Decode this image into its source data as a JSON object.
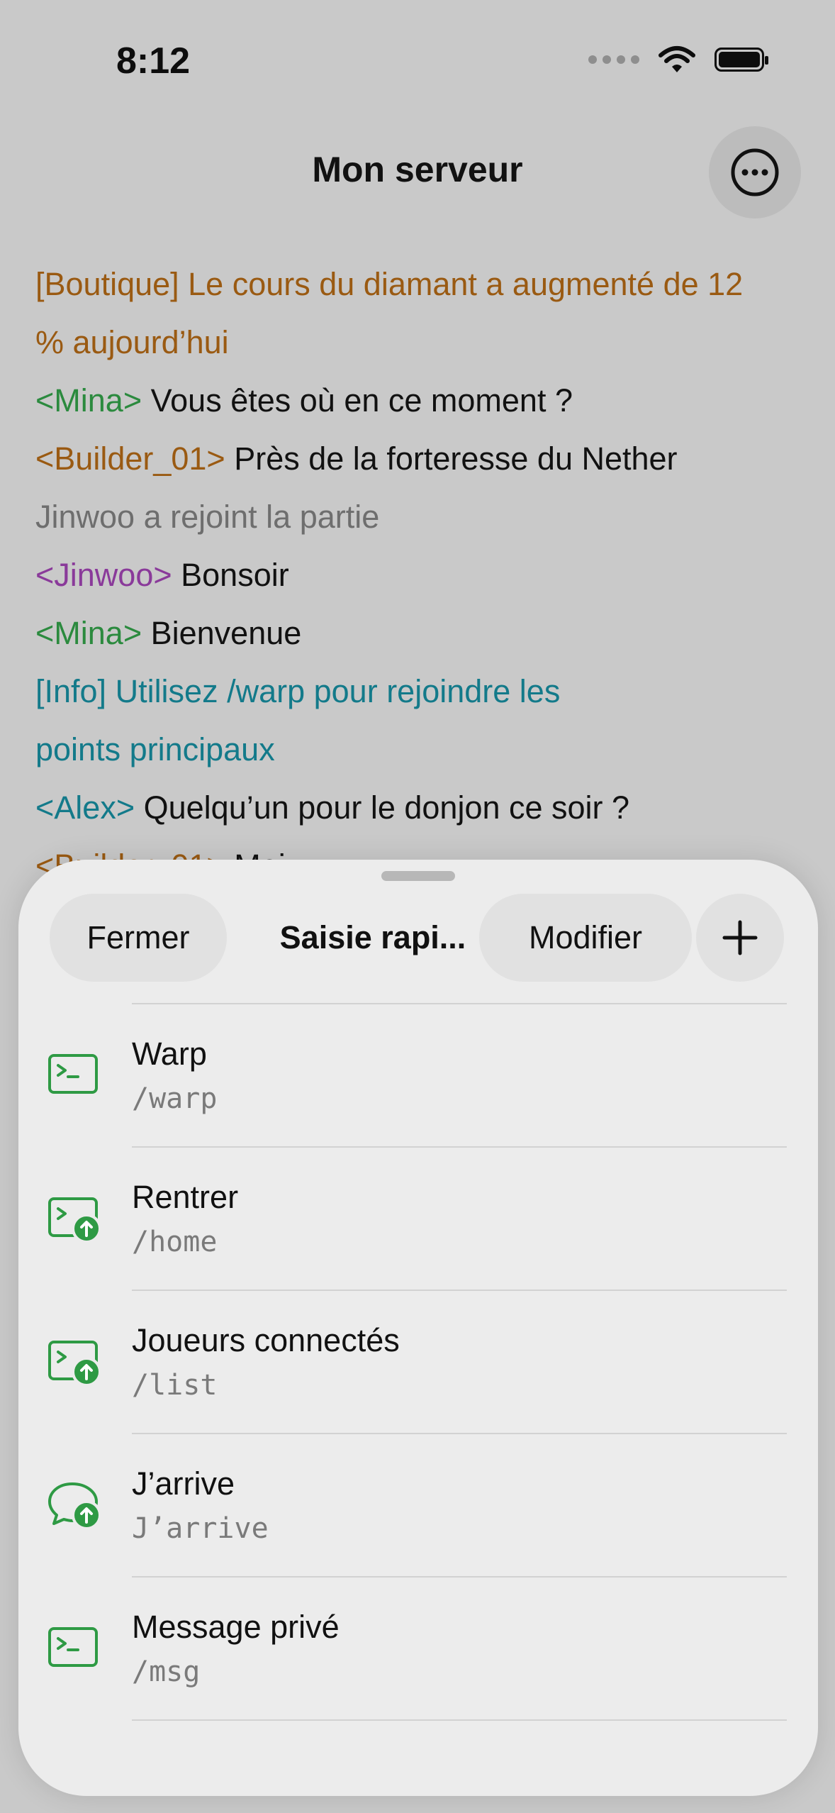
{
  "status_bar": {
    "time": "8:12"
  },
  "nav": {
    "title": "Mon serveur",
    "more_icon": "ellipsis-circle-icon"
  },
  "chat": [
    {
      "prefix": "",
      "text": "[Boutique] Le cours du diamant a augmenté de 12",
      "style": "shop"
    },
    {
      "prefix": "",
      "text": "% aujourd’hui",
      "style": "shop"
    },
    {
      "prefix": "<Mina>",
      "text": " Vous êtes où en ce moment ?",
      "style": "mina"
    },
    {
      "prefix": "<Builder_01>",
      "text": " Près de la forteresse du Nether",
      "style": "builder"
    },
    {
      "prefix": "",
      "text": "Jinwoo a rejoint la partie",
      "style": "sys"
    },
    {
      "prefix": "<Jinwoo>",
      "text": " Bonsoir",
      "style": "jinwoo"
    },
    {
      "prefix": "<Mina>",
      "text": " Bienvenue",
      "style": "mina"
    },
    {
      "prefix": "",
      "text": "[Info] Utilisez /warp pour rejoindre les",
      "style": "info"
    },
    {
      "prefix": "",
      "text": "points principaux",
      "style": "info"
    },
    {
      "prefix": "<Alex>",
      "text": " Quelqu’un pour le donjon ce soir ?",
      "style": "alex"
    },
    {
      "prefix": "<Builder_01>",
      "text": " Moi",
      "style": "builder"
    }
  ],
  "sheet": {
    "close_label": "Fermer",
    "title": "Saisie rapi...",
    "edit_label": "Modifier",
    "add_icon": "plus-icon"
  },
  "quick_items": [
    {
      "title": "Warp",
      "command": "/warp",
      "icon": "terminal-icon"
    },
    {
      "title": "Rentrer",
      "command": "/home",
      "icon": "terminal-send-icon"
    },
    {
      "title": "Joueurs connectés",
      "command": "/list",
      "icon": "terminal-send-icon"
    },
    {
      "title": "J’arrive",
      "command": "J’arrive",
      "icon": "chat-bubble-send-icon"
    },
    {
      "title": "Message privé",
      "command": "/msg",
      "icon": "terminal-icon"
    }
  ],
  "colors": {
    "accent_green": "#2e9a44",
    "shop": "#9a5a12",
    "mina": "#2b8a3e",
    "jinwoo": "#8a3a9a",
    "info": "#137a8a",
    "system": "#6e6e6e"
  }
}
